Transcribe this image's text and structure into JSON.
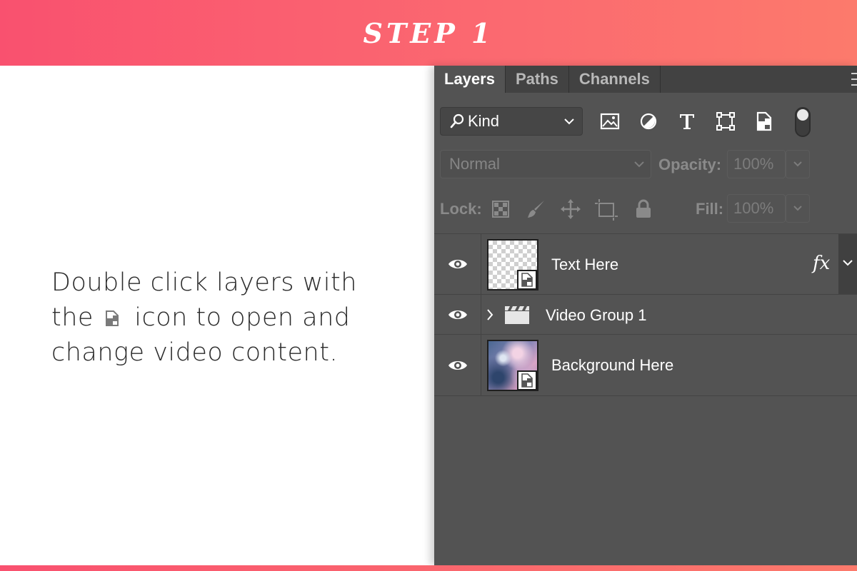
{
  "banner": {
    "title": "STEP 1"
  },
  "instructions": {
    "line1": "Double click layers with",
    "line2_before": "the",
    "line2_after": "icon to open and",
    "line3": "change video content.",
    "inline_icon": "smart-object-icon"
  },
  "colors": {
    "banner_start": "#f9516f",
    "banner_end": "#fc7a6c",
    "panel_bg": "#535353",
    "tab_bar_bg": "#424242"
  },
  "panel": {
    "tabs": [
      {
        "label": "Layers",
        "active": true
      },
      {
        "label": "Paths",
        "active": false
      },
      {
        "label": "Channels",
        "active": false
      }
    ],
    "filter": {
      "kind_label": "Kind",
      "icons": [
        "image-filter-icon",
        "adjustment-filter-icon",
        "type-filter-icon",
        "shape-filter-icon",
        "smart-object-filter-icon"
      ],
      "toggle": "filter-toggle"
    },
    "blend": {
      "mode": "Normal",
      "opacity_label": "Opacity:",
      "opacity_value": "100%"
    },
    "lock": {
      "label": "Lock:",
      "icons": [
        "lock-transparent-icon",
        "lock-image-icon",
        "lock-position-icon",
        "lock-artboard-icon",
        "lock-all-icon"
      ],
      "fill_label": "Fill:",
      "fill_value": "100%"
    },
    "layers": [
      {
        "name": "Text Here",
        "type": "smart-object",
        "visible": true,
        "fx": "fx"
      },
      {
        "name": "Video Group 1",
        "type": "video-group",
        "visible": true
      },
      {
        "name": "Background Here",
        "type": "smart-object",
        "visible": true
      }
    ]
  }
}
